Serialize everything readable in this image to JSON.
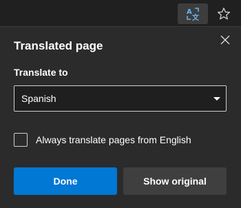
{
  "toolbar": {
    "translate_icon": "translate-icon",
    "favorite_icon": "star-icon"
  },
  "panel": {
    "title": "Translated page",
    "translate_to_label": "Translate to",
    "language_selected": "Spanish",
    "always_translate_label": "Always translate pages from English",
    "always_translate_checked": false,
    "done_label": "Done",
    "show_original_label": "Show original"
  },
  "colors": {
    "accent": "#0078d4",
    "translate_icon": "#6bb3f0"
  }
}
